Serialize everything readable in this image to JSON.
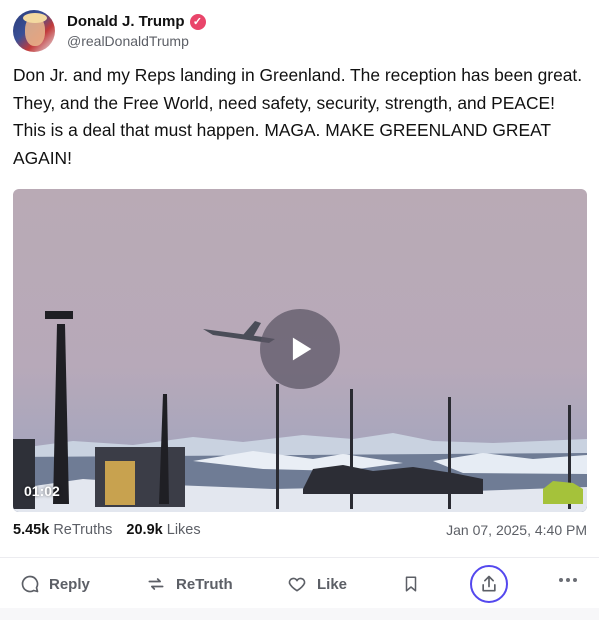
{
  "author": {
    "display_name": "Donald J. Trump",
    "handle": "@realDonaldTrump",
    "verified_icon": "verified-badge-icon",
    "accent_color": "#e9456a"
  },
  "post": {
    "text": "Don Jr. and my Reps landing in Greenland. The reception has been great. They, and the Free World, need safety, security, strength, and PEACE! This is a deal that must happen. MAGA. MAKE GREENLAND GREAT AGAIN!"
  },
  "video": {
    "duration": "01:02",
    "play_icon": "play-icon"
  },
  "stats": {
    "retruths_count": "5.45k",
    "retruths_label": "ReTruths",
    "likes_count": "20.9k",
    "likes_label": "Likes",
    "timestamp": "Jan 07, 2025, 4:40 PM"
  },
  "actions": {
    "reply": "Reply",
    "retruth": "ReTruth",
    "like": "Like",
    "share_accent": "#5448ee"
  }
}
